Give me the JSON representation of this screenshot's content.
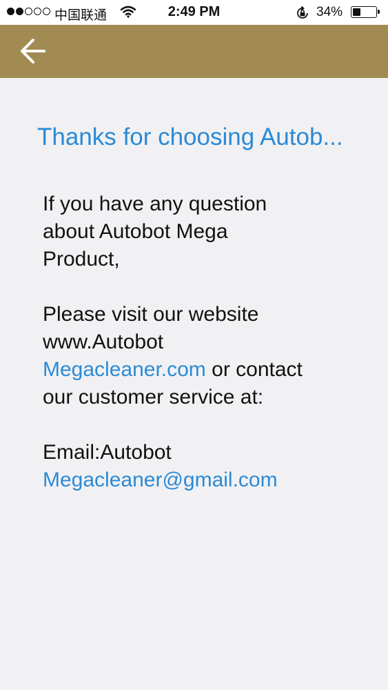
{
  "status_bar": {
    "carrier": "中国联通",
    "time": "2:49 PM",
    "battery_percent": "34%",
    "battery_level": 0.34,
    "signal_bars_filled": 2,
    "signal_bars_total": 5
  },
  "nav": {
    "back_icon": "arrow-left-icon",
    "bar_color": "#a28b52"
  },
  "content": {
    "headline": "Thanks for choosing Autob...",
    "question_line1": "If you have any question",
    "question_line2": "about Autobot Mega",
    "question_line3": "Product,",
    "visit_line1": "Please visit our website",
    "visit_line2": "www.Autobot",
    "website_link": "Megacleaner.com",
    "visit_line3_tail": " or contact",
    "visit_line4": "our customer service at:",
    "email_label": "Email:Autobot",
    "email_link": "Megacleaner@gmail.com"
  },
  "colors": {
    "accent": "#2b8ad4",
    "background": "#f1f1f4"
  }
}
